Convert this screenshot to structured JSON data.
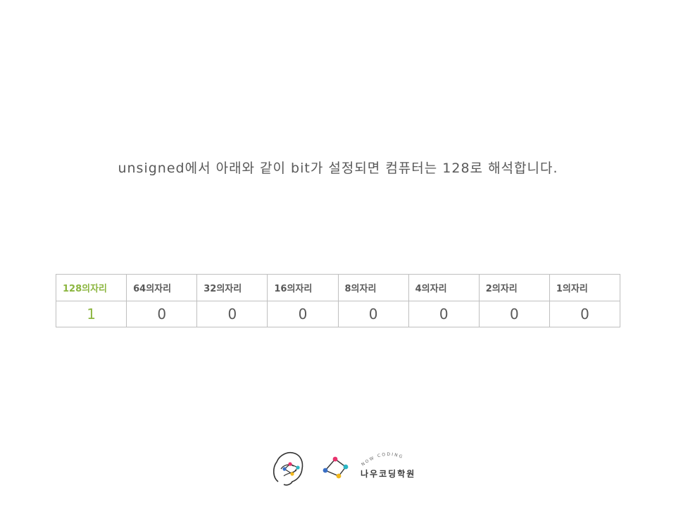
{
  "headline": "unsigned에서 아래와 같이 bit가 설정되면 컴퓨터는 128로 해석합니다.",
  "table": {
    "headers": [
      "128의자리",
      "64의자리",
      "32의자리",
      "16의자리",
      "8의자리",
      "4의자리",
      "2의자리",
      "1의자리"
    ],
    "values": [
      "1",
      "0",
      "0",
      "0",
      "0",
      "0",
      "0",
      "0"
    ],
    "highlight_color": "#8cb640"
  },
  "brand": {
    "name": "나우코딩학원",
    "arc_text": "NOW CODING",
    "dot_colors": [
      "#e8336d",
      "#2bb6c4",
      "#f2b81d",
      "#3a6fc4"
    ]
  }
}
